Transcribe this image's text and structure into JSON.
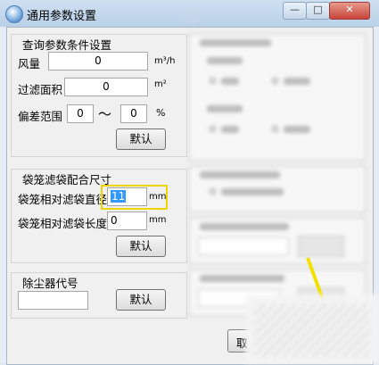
{
  "window": {
    "title": "通用参数设置",
    "minimize_glyph": "—",
    "maximize_glyph": "□",
    "close_glyph": "✕"
  },
  "query_group": {
    "title": "查询参数条件设置",
    "air_volume_label": "风量",
    "air_volume_value": "0",
    "air_volume_unit": "m³/h",
    "filter_area_label": "过滤面积",
    "filter_area_value": "0",
    "filter_area_unit": "m²",
    "deviation_label": "偏差范围",
    "deviation_from": "0",
    "deviation_tilde": "～",
    "deviation_to": "0",
    "deviation_unit": "%",
    "default_button": "默认"
  },
  "bag_group": {
    "title": "袋笼滤袋配合尺寸",
    "diameter_label": "袋笼相对滤袋直径",
    "diameter_value": "11",
    "diameter_unit": "mm",
    "length_label": "袋笼相对滤袋长度",
    "length_value": "0",
    "length_unit": "mm",
    "default_button": "默认"
  },
  "dust_group": {
    "title": "除尘器代号",
    "code_value": "",
    "default_button": "默认"
  },
  "footer": {
    "partial_button_label": "取"
  },
  "colors": {
    "highlight": "#f0d400",
    "selection": "#3399ff"
  }
}
